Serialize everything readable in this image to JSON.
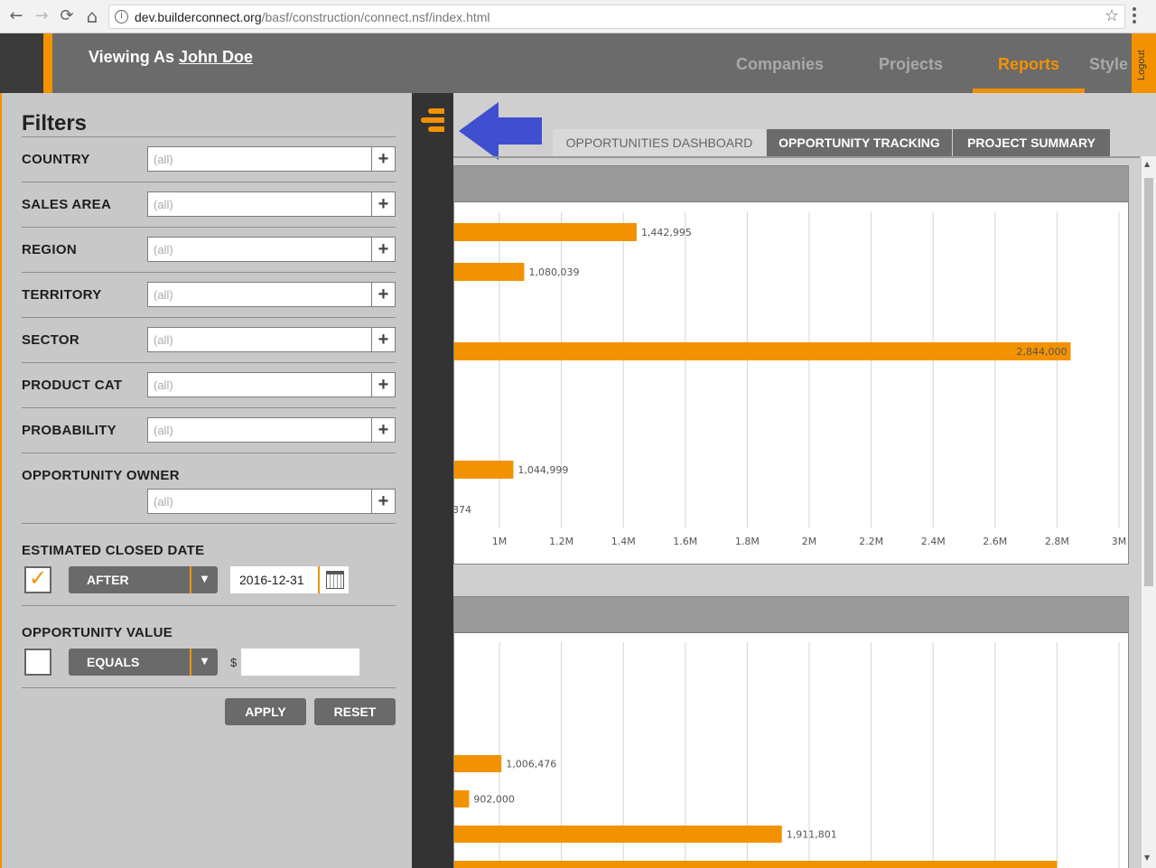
{
  "browser": {
    "back": "←",
    "forward": "→",
    "reload": "⟳",
    "home": "⌂",
    "url_host": "dev.builderconnect.org",
    "url_path": "/basf/construction/connect.nsf/index.html",
    "info_icon": "i",
    "star_icon": "☆"
  },
  "header": {
    "viewing_prefix": "Viewing As ",
    "user": "John Doe",
    "nav": [
      "Companies",
      "Projects",
      "Reports",
      "Style"
    ],
    "active_nav": "Reports",
    "logout": "Logout",
    "accent": "#f39200"
  },
  "filters": {
    "title": "Filters",
    "fields": [
      {
        "label": "COUNTRY",
        "placeholder": "(all)"
      },
      {
        "label": "SALES AREA",
        "placeholder": "(all)"
      },
      {
        "label": "REGION",
        "placeholder": "(all)"
      },
      {
        "label": "TERRITORY",
        "placeholder": "(all)"
      },
      {
        "label": "SECTOR",
        "placeholder": "(all)"
      },
      {
        "label": "PRODUCT CAT",
        "placeholder": "(all)"
      },
      {
        "label": "PROBABILITY",
        "placeholder": "(all)"
      },
      {
        "label": "OPPORTUNITY OWNER",
        "placeholder": "(all)"
      }
    ],
    "plus": "+",
    "closed_date": {
      "label": "ESTIMATED CLOSED DATE",
      "checked": true,
      "operator": "AFTER",
      "date": "2016-12-31"
    },
    "opp_value": {
      "label": "OPPORTUNITY VALUE",
      "checked": false,
      "operator": "EQUALS",
      "currency": "$",
      "value": ""
    },
    "apply": "APPLY",
    "reset": "RESET",
    "check_mark": "✓",
    "caret": "▼"
  },
  "tabs": [
    "OPPORTUNITIES DASHBOARD",
    "OPPORTUNITY TRACKING",
    "PROJECT SUMMARY"
  ],
  "active_tab": "OPPORTUNITIES DASHBOARD",
  "chart_data": [
    {
      "type": "bar",
      "orientation": "horizontal",
      "values": [
        1442995,
        1080039,
        null,
        2844000,
        null,
        null,
        1044999,
        null
      ],
      "labels": [
        "1,442,995",
        "1,080,039",
        "",
        "2,844,000",
        "",
        "",
        "1,044,999",
        "374"
      ],
      "x_ticks": [
        "1M",
        "1.2M",
        "1.4M",
        "1.6M",
        "1.8M",
        "2M",
        "2.2M",
        "2.4M",
        "2.6M",
        "2.8M",
        "3M"
      ],
      "xlim_visible": [
        700000,
        3000000
      ],
      "bar_color": "#f39200",
      "grid": true
    },
    {
      "type": "bar",
      "orientation": "horizontal",
      "values": [
        1006476,
        902000,
        1911801,
        2800000
      ],
      "labels": [
        "1,006,476",
        "902,000",
        "1,911,801",
        ""
      ],
      "xlim_visible": [
        700000,
        3000000
      ],
      "bar_color": "#f39200",
      "grid": true
    }
  ]
}
